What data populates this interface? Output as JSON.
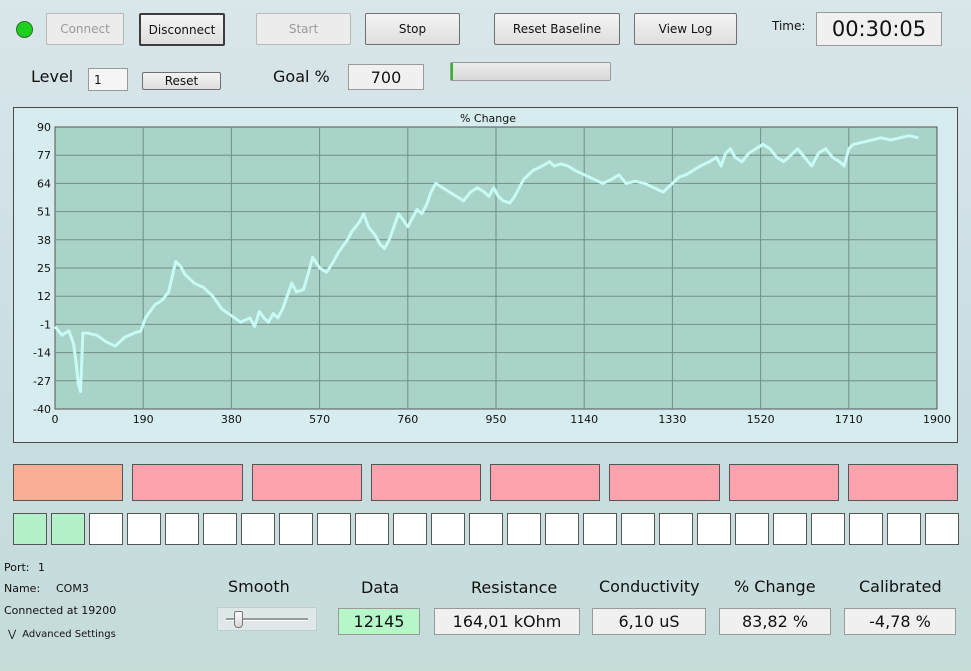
{
  "toolbar": {
    "connect_label": "Connect",
    "disconnect_label": "Disconnect",
    "start_label": "Start",
    "stop_label": "Stop",
    "reset_baseline_label": "Reset Baseline",
    "view_log_label": "View Log",
    "time_label": "Time:",
    "time_value": "00:30:05",
    "status_color": "#1ed01e"
  },
  "controls": {
    "level_label": "Level",
    "level_value": "1",
    "reset_label": "Reset",
    "goal_label": "Goal %",
    "goal_value": "700",
    "goal_progress": 0.005
  },
  "chart_data": {
    "type": "line",
    "title": "% Change",
    "xlabel": "",
    "ylabel": "",
    "xlim": [
      0,
      1900
    ],
    "ylim": [
      -40,
      90
    ],
    "xticks": [
      0,
      190,
      380,
      570,
      760,
      950,
      1140,
      1330,
      1520,
      1710,
      1900
    ],
    "yticks": [
      90,
      77,
      64,
      51,
      38,
      25,
      12,
      -1,
      -14,
      -27,
      -40
    ],
    "grid": true,
    "line_color": "#c8fbf4",
    "background": "#a9d2c8",
    "x": [
      0,
      15,
      30,
      40,
      45,
      50,
      55,
      60,
      70,
      90,
      110,
      130,
      150,
      170,
      185,
      195,
      205,
      215,
      230,
      245,
      260,
      270,
      280,
      300,
      320,
      340,
      360,
      380,
      400,
      420,
      430,
      440,
      450,
      460,
      470,
      480,
      490,
      500,
      510,
      520,
      535,
      545,
      555,
      570,
      585,
      600,
      610,
      620,
      630,
      640,
      655,
      665,
      675,
      690,
      700,
      710,
      720,
      730,
      740,
      750,
      760,
      770,
      780,
      790,
      800,
      810,
      820,
      835,
      850,
      865,
      880,
      895,
      910,
      925,
      935,
      945,
      955,
      965,
      980,
      990,
      1000,
      1010,
      1030,
      1050,
      1065,
      1075,
      1090,
      1105,
      1120,
      1140,
      1160,
      1180,
      1200,
      1215,
      1230,
      1250,
      1270,
      1290,
      1310,
      1330,
      1345,
      1360,
      1375,
      1390,
      1410,
      1425,
      1435,
      1445,
      1455,
      1465,
      1480,
      1495,
      1510,
      1525,
      1540,
      1555,
      1570,
      1585,
      1600,
      1615,
      1630,
      1645,
      1660,
      1675,
      1690,
      1700,
      1710,
      1720,
      1740,
      1760,
      1780,
      1800,
      1820,
      1840,
      1860
    ],
    "values": [
      -2,
      -6,
      -4,
      -10,
      -18,
      -28,
      -32,
      -5,
      -5,
      -6,
      -9,
      -11,
      -7,
      -5,
      -4,
      2,
      5,
      8,
      10,
      14,
      28,
      26,
      22,
      18,
      16,
      12,
      6,
      3,
      0,
      2,
      -2,
      5,
      2,
      0,
      4,
      2,
      6,
      12,
      18,
      14,
      15,
      22,
      30,
      25,
      23,
      28,
      32,
      35,
      38,
      42,
      46,
      50,
      44,
      40,
      36,
      34,
      38,
      44,
      50,
      47,
      44,
      48,
      52,
      50,
      54,
      60,
      64,
      62,
      60,
      58,
      56,
      60,
      62,
      60,
      58,
      62,
      58,
      56,
      55,
      58,
      62,
      66,
      70,
      72,
      74,
      72,
      73,
      72,
      70,
      68,
      66,
      64,
      66,
      68,
      64,
      65,
      64,
      62,
      60,
      64,
      67,
      68,
      70,
      72,
      74,
      76,
      72,
      78,
      80,
      76,
      74,
      78,
      80,
      82,
      80,
      76,
      74,
      77,
      80,
      76,
      72,
      78,
      80,
      76,
      74,
      72,
      80,
      82,
      83,
      84,
      85,
      84,
      85,
      86,
      85
    ]
  },
  "indicators": {
    "segments": [
      {
        "color": "#fbae96"
      },
      {
        "color": "#fca3ad"
      },
      {
        "color": "#fca3ad"
      },
      {
        "color": "#fca3ad"
      },
      {
        "color": "#fca3ad"
      },
      {
        "color": "#fca3ad"
      },
      {
        "color": "#fca3ad"
      },
      {
        "color": "#fca3ad"
      }
    ],
    "squares_total": 25,
    "squares_on": 2
  },
  "status": {
    "port_label": "Port:",
    "port_value": "1",
    "name_label": "Name:",
    "name_value": "COM3",
    "connected_text": "Connected at 19200",
    "advanced_label": "Advanced Settings"
  },
  "readouts": {
    "smooth_label": "Smooth",
    "smooth_level": 0.1,
    "data_label": "Data",
    "data_value": "12145",
    "data_bg": "#b6f7c8",
    "resistance_label": "Resistance",
    "resistance_value": "164,01 kOhm",
    "conductivity_label": "Conductivity",
    "conductivity_value": "6,10 uS",
    "change_label": "% Change",
    "change_value": "83,82 %",
    "calibrated_label": "Calibrated",
    "calibrated_value": "-4,78 %"
  }
}
